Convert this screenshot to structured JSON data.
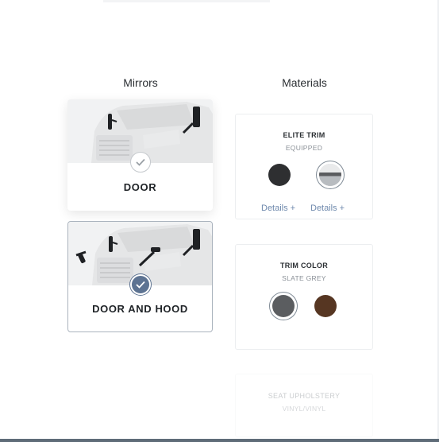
{
  "sections": {
    "mirrors_heading": "Mirrors",
    "materials_heading": "Materials"
  },
  "mirror_options": [
    {
      "label": "DOOR",
      "selected": false
    },
    {
      "label": "DOOR AND HOOD",
      "selected": true
    }
  ],
  "materials": {
    "trim": {
      "title": "ELITE TRIM",
      "subtitle": "EQUIPPED",
      "swatches": [
        {
          "name": "black-swatch",
          "color": "#2e2f31"
        },
        {
          "name": "black-silver-swatch",
          "color": "#b8bcc0",
          "selected": true
        }
      ],
      "details_1": "Details +",
      "details_2": "Details +"
    },
    "color": {
      "title": "TRIM COLOR",
      "subtitle": "SLATE GREY",
      "swatches": [
        {
          "name": "slate-grey-swatch",
          "color": "#5b5d60",
          "selected": true
        },
        {
          "name": "brown-swatch",
          "color": "#563622"
        }
      ]
    },
    "seat": {
      "title": "SEAT UPHOLSTERY",
      "subtitle": "VINYL/VINYL"
    }
  },
  "colors": {
    "accent": "#5d7392",
    "link": "#6f89ad",
    "selected_border": "#aab3bd"
  }
}
